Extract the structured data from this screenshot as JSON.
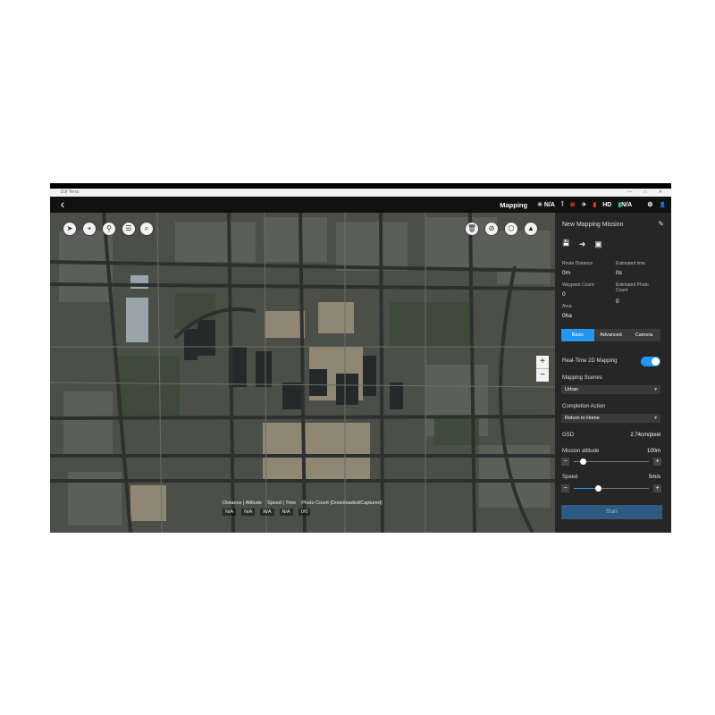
{
  "window": {
    "title": "DJI Terra",
    "controls": "—  □  ✕"
  },
  "topbar": {
    "back_icon": "‹",
    "mode": "Mapping",
    "gps_icon": "satellite-icon",
    "gps_value": "N/A",
    "signal_icon_glyph": "⟟",
    "rc_icon_glyph": "⊗",
    "drone_icon_glyph": "✈",
    "hd_label": "HD",
    "hd_bars": "▮",
    "battery_value": "N/A",
    "settings_glyph": "⚙",
    "user_glyph": "👤"
  },
  "map": {
    "tools": {
      "compass": "➤",
      "locate": "⌖",
      "pin": "⚲",
      "layers": "☰",
      "search": "⌕"
    },
    "right_tools": {
      "delete": "🗑",
      "clear": "⊘",
      "drone": "⬡",
      "nav": "▲"
    },
    "zoom_in": "+",
    "zoom_out": "−",
    "stats_headers": [
      "Distance | Altitude",
      "Speed | Time",
      "Photo Count (Downloaded/Captured)"
    ],
    "stats_values": [
      "N/A",
      "N/A",
      "N/A",
      "N/A",
      "0/0"
    ]
  },
  "panel": {
    "title": "New Mapping Mission",
    "edit_glyph": "✎",
    "save_glyph": "💾",
    "export_glyph": "➜",
    "import_glyph": "▣",
    "route_distance_label": "Route Distance",
    "route_distance_value": "0m",
    "estimated_time_label": "Estimated time",
    "estimated_time_value": "0s",
    "waypoint_count_label": "Waypoint Count",
    "waypoint_count_value": "0",
    "photo_count_label": "Estimated Photo Count",
    "photo_count_value": "0",
    "area_label": "Area",
    "area_value": "0ha",
    "tabs": [
      "Basic",
      "Advanced",
      "Camera"
    ],
    "realtime_label": "Real-Time 2D Mapping",
    "realtime_on": true,
    "scenes_label": "Mapping Scenes",
    "scenes_value": "Urban",
    "completion_label": "Completion Action",
    "completion_value": "Return to Home",
    "gsd_label": "GSD",
    "gsd_value": "2.74cm/pixel",
    "altitude_label": "Mission altitude",
    "altitude_value": "100m",
    "altitude_fraction": 0.13,
    "speed_label": "Speed",
    "speed_value": "5m/s",
    "speed_fraction": 0.33,
    "start_label": "Start",
    "accent": "#2196f3"
  }
}
